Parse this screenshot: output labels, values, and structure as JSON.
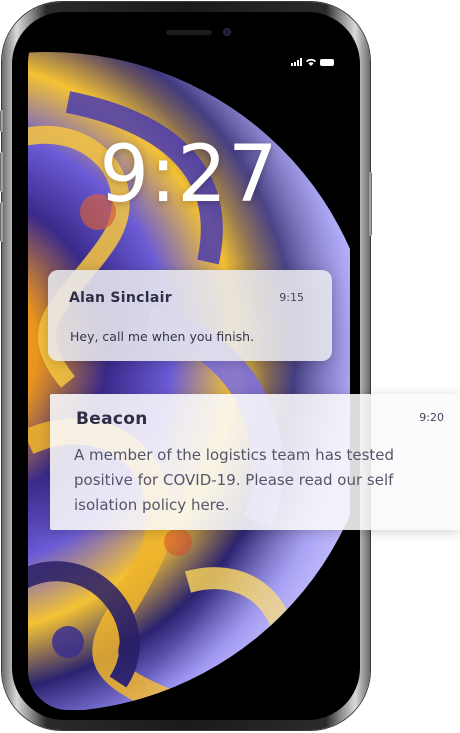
{
  "lockscreen": {
    "time": "9:27"
  },
  "notifications": [
    {
      "app": "Alan Sinclair",
      "time": "9:15",
      "message": "Hey, call me when you finish."
    },
    {
      "app": "Beacon",
      "time": "9:20",
      "message": "A member of the logistics team has tested positive for COVID-19.  Please read our self isolation policy here."
    }
  ],
  "status_bar": {
    "icons": [
      "cellular-signal-icon",
      "wifi-icon",
      "battery-icon"
    ]
  },
  "colors": {
    "notification_title": "#2e2e48",
    "notification_body": "#55556a",
    "clock": "#ffffff"
  }
}
